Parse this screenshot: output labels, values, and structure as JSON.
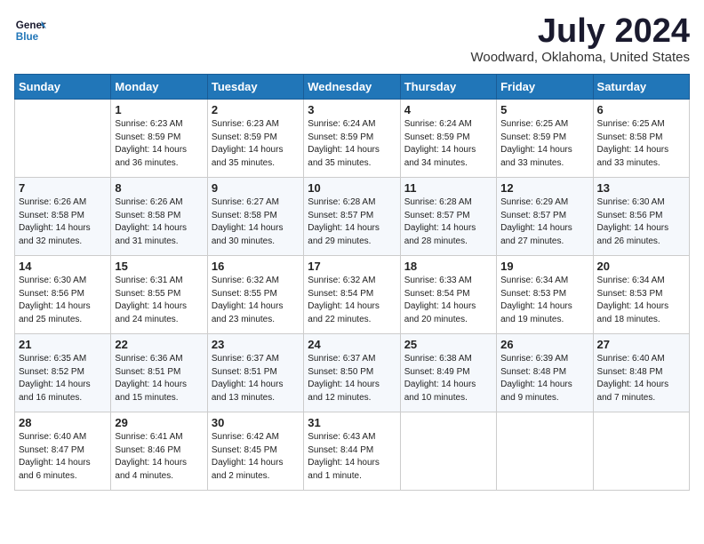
{
  "logo": {
    "line1": "General",
    "line2": "Blue"
  },
  "title": "July 2024",
  "location": "Woodward, Oklahoma, United States",
  "days_header": [
    "Sunday",
    "Monday",
    "Tuesday",
    "Wednesday",
    "Thursday",
    "Friday",
    "Saturday"
  ],
  "weeks": [
    [
      {
        "day": "",
        "info": ""
      },
      {
        "day": "1",
        "info": "Sunrise: 6:23 AM\nSunset: 8:59 PM\nDaylight: 14 hours\nand 36 minutes."
      },
      {
        "day": "2",
        "info": "Sunrise: 6:23 AM\nSunset: 8:59 PM\nDaylight: 14 hours\nand 35 minutes."
      },
      {
        "day": "3",
        "info": "Sunrise: 6:24 AM\nSunset: 8:59 PM\nDaylight: 14 hours\nand 35 minutes."
      },
      {
        "day": "4",
        "info": "Sunrise: 6:24 AM\nSunset: 8:59 PM\nDaylight: 14 hours\nand 34 minutes."
      },
      {
        "day": "5",
        "info": "Sunrise: 6:25 AM\nSunset: 8:59 PM\nDaylight: 14 hours\nand 33 minutes."
      },
      {
        "day": "6",
        "info": "Sunrise: 6:25 AM\nSunset: 8:58 PM\nDaylight: 14 hours\nand 33 minutes."
      }
    ],
    [
      {
        "day": "7",
        "info": "Sunrise: 6:26 AM\nSunset: 8:58 PM\nDaylight: 14 hours\nand 32 minutes."
      },
      {
        "day": "8",
        "info": "Sunrise: 6:26 AM\nSunset: 8:58 PM\nDaylight: 14 hours\nand 31 minutes."
      },
      {
        "day": "9",
        "info": "Sunrise: 6:27 AM\nSunset: 8:58 PM\nDaylight: 14 hours\nand 30 minutes."
      },
      {
        "day": "10",
        "info": "Sunrise: 6:28 AM\nSunset: 8:57 PM\nDaylight: 14 hours\nand 29 minutes."
      },
      {
        "day": "11",
        "info": "Sunrise: 6:28 AM\nSunset: 8:57 PM\nDaylight: 14 hours\nand 28 minutes."
      },
      {
        "day": "12",
        "info": "Sunrise: 6:29 AM\nSunset: 8:57 PM\nDaylight: 14 hours\nand 27 minutes."
      },
      {
        "day": "13",
        "info": "Sunrise: 6:30 AM\nSunset: 8:56 PM\nDaylight: 14 hours\nand 26 minutes."
      }
    ],
    [
      {
        "day": "14",
        "info": "Sunrise: 6:30 AM\nSunset: 8:56 PM\nDaylight: 14 hours\nand 25 minutes."
      },
      {
        "day": "15",
        "info": "Sunrise: 6:31 AM\nSunset: 8:55 PM\nDaylight: 14 hours\nand 24 minutes."
      },
      {
        "day": "16",
        "info": "Sunrise: 6:32 AM\nSunset: 8:55 PM\nDaylight: 14 hours\nand 23 minutes."
      },
      {
        "day": "17",
        "info": "Sunrise: 6:32 AM\nSunset: 8:54 PM\nDaylight: 14 hours\nand 22 minutes."
      },
      {
        "day": "18",
        "info": "Sunrise: 6:33 AM\nSunset: 8:54 PM\nDaylight: 14 hours\nand 20 minutes."
      },
      {
        "day": "19",
        "info": "Sunrise: 6:34 AM\nSunset: 8:53 PM\nDaylight: 14 hours\nand 19 minutes."
      },
      {
        "day": "20",
        "info": "Sunrise: 6:34 AM\nSunset: 8:53 PM\nDaylight: 14 hours\nand 18 minutes."
      }
    ],
    [
      {
        "day": "21",
        "info": "Sunrise: 6:35 AM\nSunset: 8:52 PM\nDaylight: 14 hours\nand 16 minutes."
      },
      {
        "day": "22",
        "info": "Sunrise: 6:36 AM\nSunset: 8:51 PM\nDaylight: 14 hours\nand 15 minutes."
      },
      {
        "day": "23",
        "info": "Sunrise: 6:37 AM\nSunset: 8:51 PM\nDaylight: 14 hours\nand 13 minutes."
      },
      {
        "day": "24",
        "info": "Sunrise: 6:37 AM\nSunset: 8:50 PM\nDaylight: 14 hours\nand 12 minutes."
      },
      {
        "day": "25",
        "info": "Sunrise: 6:38 AM\nSunset: 8:49 PM\nDaylight: 14 hours\nand 10 minutes."
      },
      {
        "day": "26",
        "info": "Sunrise: 6:39 AM\nSunset: 8:48 PM\nDaylight: 14 hours\nand 9 minutes."
      },
      {
        "day": "27",
        "info": "Sunrise: 6:40 AM\nSunset: 8:48 PM\nDaylight: 14 hours\nand 7 minutes."
      }
    ],
    [
      {
        "day": "28",
        "info": "Sunrise: 6:40 AM\nSunset: 8:47 PM\nDaylight: 14 hours\nand 6 minutes."
      },
      {
        "day": "29",
        "info": "Sunrise: 6:41 AM\nSunset: 8:46 PM\nDaylight: 14 hours\nand 4 minutes."
      },
      {
        "day": "30",
        "info": "Sunrise: 6:42 AM\nSunset: 8:45 PM\nDaylight: 14 hours\nand 2 minutes."
      },
      {
        "day": "31",
        "info": "Sunrise: 6:43 AM\nSunset: 8:44 PM\nDaylight: 14 hours\nand 1 minute."
      },
      {
        "day": "",
        "info": ""
      },
      {
        "day": "",
        "info": ""
      },
      {
        "day": "",
        "info": ""
      }
    ]
  ]
}
